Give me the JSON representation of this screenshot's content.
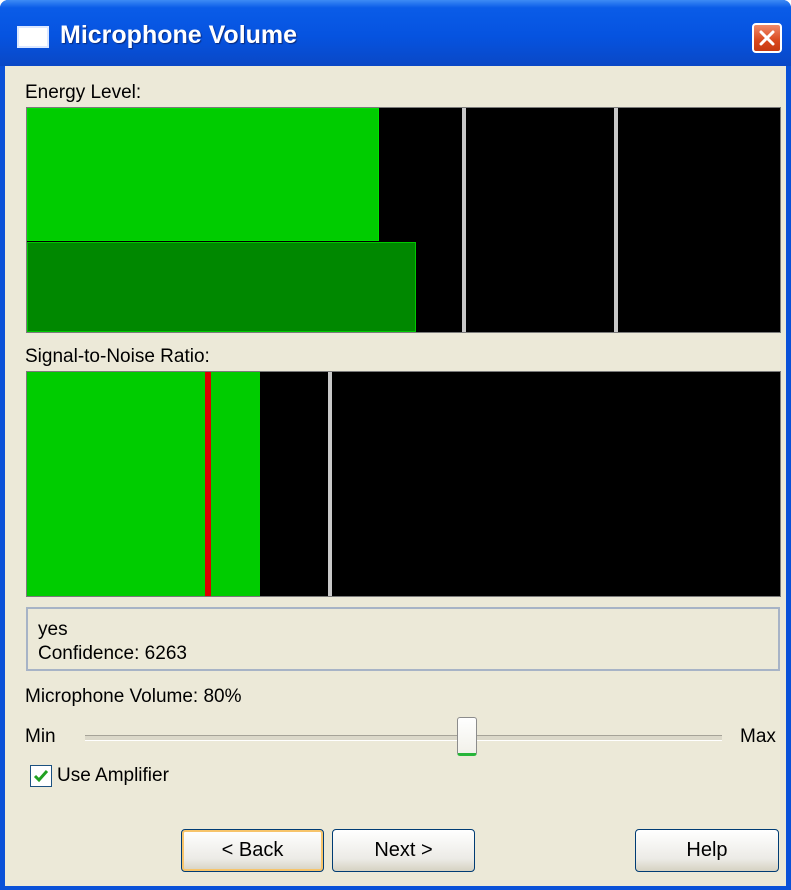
{
  "window": {
    "title": "Microphone Volume"
  },
  "energy": {
    "label": "Energy Level:",
    "bars": [
      {
        "name": "current-energy",
        "level_fraction": 0.467,
        "color": "#00cc00"
      },
      {
        "name": "peak-energy",
        "level_fraction": 0.517,
        "color": "#008800"
      }
    ],
    "threshold_fractions": [
      0.578,
      0.78
    ]
  },
  "snr": {
    "label": "Signal-to-Noise Ratio:",
    "level_fraction": 0.31,
    "peak_marker_fraction": 0.237,
    "threshold_fraction": 0.4,
    "color": "#00cc00",
    "marker_color": "#dd0000"
  },
  "recognition": {
    "word": "yes",
    "confidence": "Confidence: 6263"
  },
  "volume": {
    "label": "Microphone Volume:  80%",
    "min_label": "Min",
    "max_label": "Max",
    "slider_fraction": 0.6
  },
  "amplifier": {
    "label": "Use Amplifier",
    "checked": true
  },
  "buttons": {
    "back": "< Back",
    "next": "Next >",
    "help": "Help"
  }
}
